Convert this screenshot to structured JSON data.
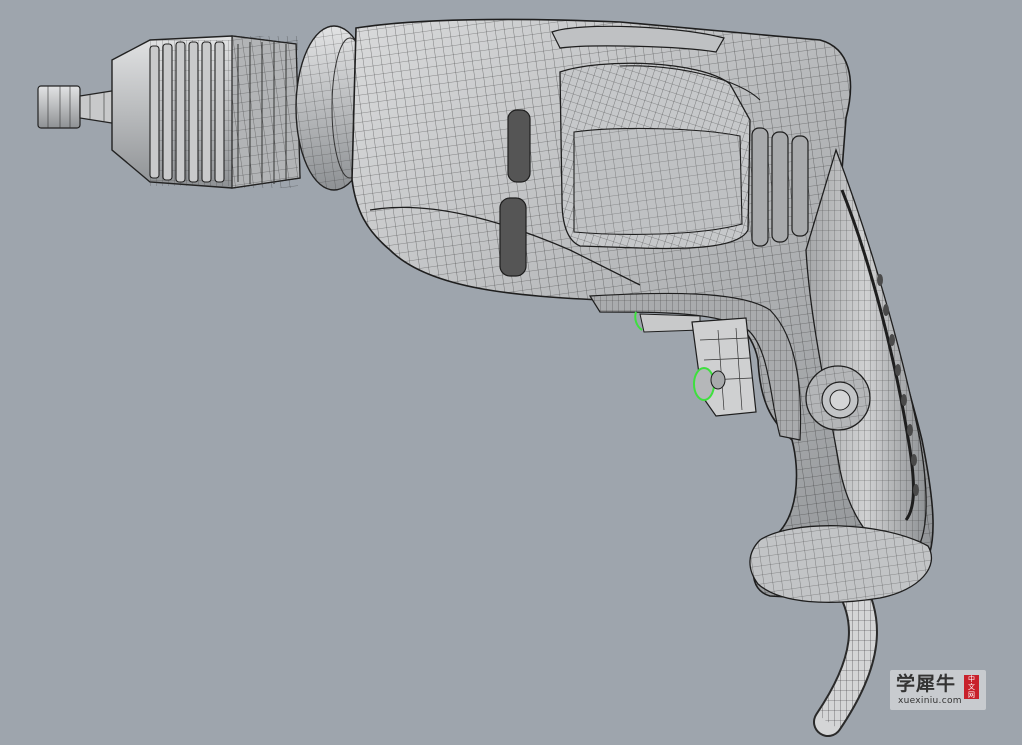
{
  "viewport": {
    "background_color": "#9ea5ad",
    "display_mode": "shaded-with-wireframe-mesh",
    "model": "electric-drill",
    "highlight_color": "#3ee03e"
  },
  "watermark": {
    "text_cn": "学犀牛",
    "badge": "中文网",
    "url": "xuexiniu.com"
  }
}
